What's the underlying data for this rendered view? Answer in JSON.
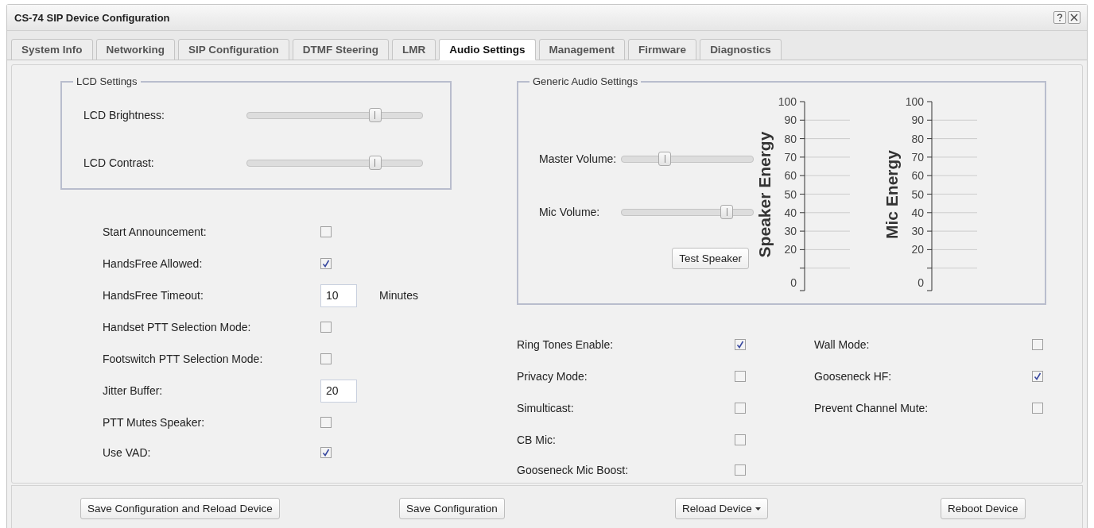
{
  "window": {
    "title": "CS-74 SIP Device Configuration"
  },
  "tabs": [
    {
      "label": "System Info",
      "selected": false
    },
    {
      "label": "Networking",
      "selected": false
    },
    {
      "label": "SIP Configuration",
      "selected": false
    },
    {
      "label": "DTMF Steering",
      "selected": false
    },
    {
      "label": "LMR",
      "selected": false
    },
    {
      "label": "Audio Settings",
      "selected": true
    },
    {
      "label": "Management",
      "selected": false
    },
    {
      "label": "Firmware",
      "selected": false
    },
    {
      "label": "Diagnostics",
      "selected": false
    }
  ],
  "lcd_settings": {
    "legend": "LCD Settings",
    "sliders": [
      {
        "label": "LCD Brightness:",
        "level": 0.73
      },
      {
        "label": "LCD Contrast:",
        "level": 0.73
      }
    ]
  },
  "options": [
    {
      "kind": "checkbox",
      "label": "Start Announcement:",
      "checked": false
    },
    {
      "kind": "checkbox",
      "label": "HandsFree Allowed:",
      "checked": true
    },
    {
      "kind": "input",
      "label": "HandsFree Timeout:",
      "value": "10",
      "unit": "Minutes"
    },
    {
      "kind": "checkbox",
      "label": "Handset PTT Selection Mode:",
      "checked": false
    },
    {
      "kind": "checkbox",
      "label": "Footswitch PTT Selection Mode:",
      "checked": false
    },
    {
      "kind": "input",
      "label": "Jitter Buffer:",
      "value": "20"
    },
    {
      "kind": "checkbox",
      "label": "PTT Mutes Speaker:",
      "checked": false
    },
    {
      "kind": "checkbox",
      "label": "Use VAD:",
      "checked": true
    }
  ],
  "generic_audio": {
    "legend": "Generic Audio Settings",
    "sliders": [
      {
        "label": "Master Volume:",
        "level": 0.33
      },
      {
        "label": "Mic Volume:",
        "level": 0.8
      }
    ],
    "test_button": "Test Speaker",
    "meters": [
      {
        "title": "Speaker Energy",
        "ticks": [
          "100",
          "90",
          "80",
          "70",
          "60",
          "50",
          "40",
          "30",
          "20"
        ],
        "zero": "0"
      },
      {
        "title": "Mic Energy",
        "ticks": [
          "100",
          "90",
          "80",
          "70",
          "60",
          "50",
          "40",
          "30",
          "20"
        ],
        "zero": "0"
      }
    ]
  },
  "audio_options": [
    [
      {
        "label": "Ring Tones Enable:",
        "checked": true
      },
      {
        "label": "Privacy Mode:",
        "checked": false
      },
      {
        "label": "Simulticast:",
        "checked": false
      },
      {
        "label": "CB Mic:",
        "checked": false
      },
      {
        "label": "Gooseneck Mic Boost:",
        "checked": false
      }
    ],
    [
      {
        "label": "Wall Mode:",
        "checked": false
      },
      {
        "label": "Gooseneck HF:",
        "checked": true
      },
      {
        "label": "Prevent Channel Mute:",
        "checked": false
      }
    ]
  ],
  "footer": [
    {
      "kind": "button",
      "label": "Save Configuration and Reload Device"
    },
    {
      "kind": "button",
      "label": "Save Configuration"
    },
    {
      "kind": "dropdown",
      "label": "Reload Device"
    },
    {
      "kind": "button",
      "label": "Reboot Device"
    }
  ]
}
